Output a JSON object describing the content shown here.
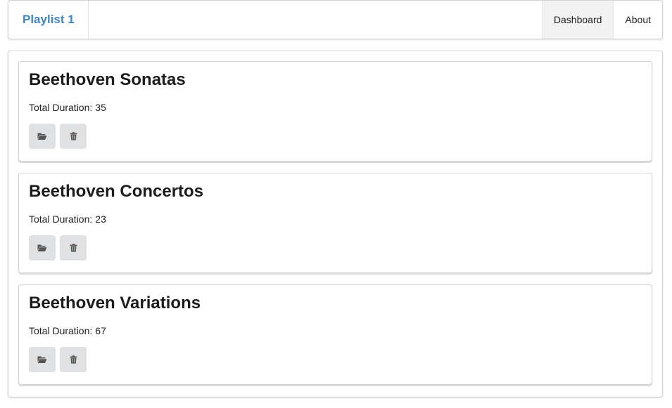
{
  "nav": {
    "brand": "Playlist 1",
    "items": [
      {
        "label": "Dashboard",
        "active": true
      },
      {
        "label": "About",
        "active": false
      }
    ]
  },
  "playlists": [
    {
      "title": "Beethoven Sonatas",
      "duration_label": "Total Duration:",
      "duration": "35"
    },
    {
      "title": "Beethoven Concertos",
      "duration_label": "Total Duration:",
      "duration": "23"
    },
    {
      "title": "Beethoven Variations",
      "duration_label": "Total Duration:",
      "duration": "67"
    }
  ],
  "icons": {
    "open": "folder-open-icon",
    "delete": "trash-icon"
  },
  "colors": {
    "brand": "#4183c4",
    "button_bg": "#e0e1e2",
    "active_nav_bg": "#f2f2f2",
    "icon": "#555555"
  }
}
